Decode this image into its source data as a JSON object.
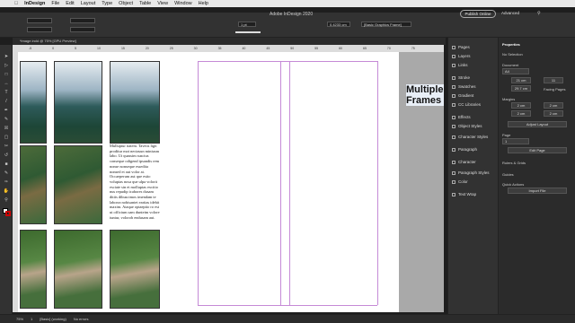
{
  "menubar": {
    "items": [
      "InDesign",
      "File",
      "Edit",
      "Layout",
      "Type",
      "Object",
      "Table",
      "View",
      "Window",
      "Help"
    ]
  },
  "title": "Adobe InDesign 2020",
  "control": {
    "publish": "Publish Online",
    "workspace": "Advanced",
    "zoom_field": "0.4233 cm",
    "stroke": "1 pt",
    "style_field": "[Basic Graphics Frame]"
  },
  "document_tab": "*image.indd @ 75% [GPU Preview]",
  "ruler_ticks": [
    "-5",
    "0",
    "5",
    "10",
    "15",
    "20",
    "25",
    "30",
    "35",
    "40",
    "45",
    "50",
    "55",
    "60",
    "65",
    "70",
    "75"
  ],
  "canvas": {
    "title": "Multiple Frames",
    "body_text": "Mulluptur itatem. Taveos ligit proditur mot nectasun miniusm labo. Ut quassim suscius conseque odigend ipsandis rem nonse nonseque essedita nonsed et aut volor at. Occaeperum aut que estio voluptas nosa que ulpa volorit esciate sin et molluptas excitio nus repudip icabores dusam ditiis dibuscimos imendam te laborra nobisantet earitas idebit maxim. Ataque optaeptio ro est ut officium sam dunteim volore iuntur, volorob endusam aut."
  },
  "panel_mid": [
    "Pages",
    "Layers",
    "Links",
    "Stroke",
    "Swatches",
    "Gradient",
    "CC Libraries",
    "Effects",
    "Object Styles",
    "Character Styles",
    "Paragraph",
    "Character",
    "Paragraph Styles",
    "Color",
    "Text Wrap"
  ],
  "properties": {
    "title": "Properties",
    "selection": "No Selection",
    "document": "Document",
    "page_size": "A4",
    "w": "21 cm",
    "h": "29.7 cm",
    "pages": "11",
    "facing": "Facing Pages",
    "margins": "Margins",
    "m1": "2 cm",
    "m2": "2 cm",
    "m3": "2 cm",
    "m4": "2 cm",
    "adjust": "Adjust Layout",
    "page": "Page",
    "page_num": "1",
    "edit_page": "Edit Page",
    "rulers": "Rulers & Grids",
    "guides": "Guides",
    "quick": "Quick Actions",
    "import": "Import File"
  },
  "status": {
    "zoom": "75%",
    "page": "1",
    "style": "[Basic] (working)",
    "errors": "No errors"
  }
}
